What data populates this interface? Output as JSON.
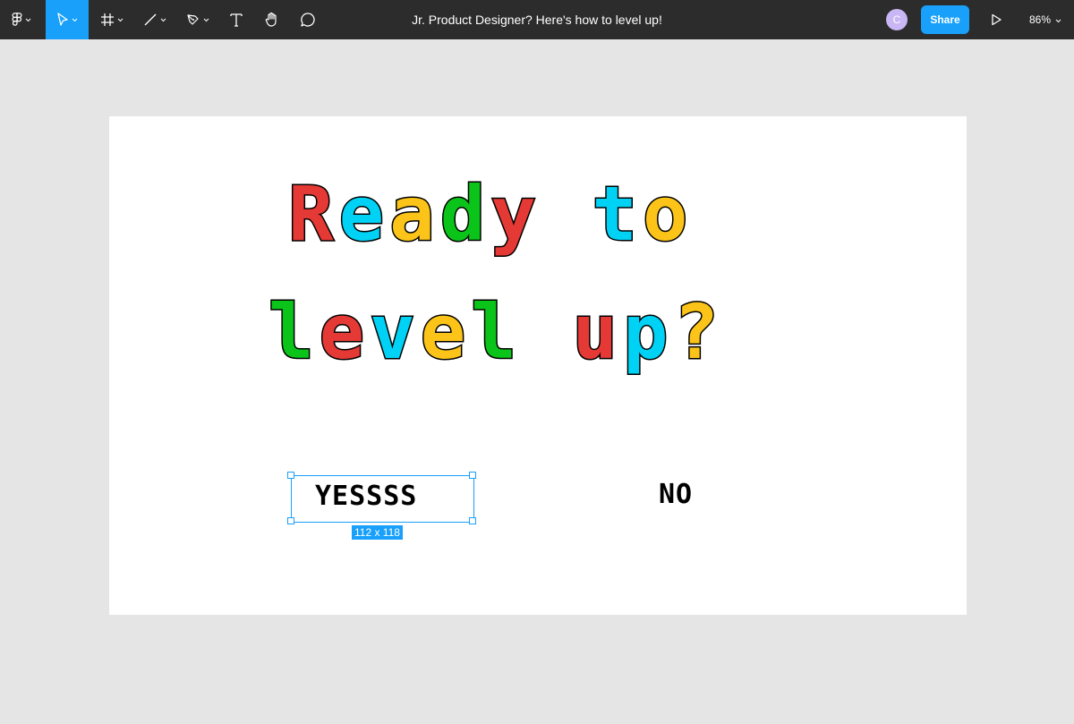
{
  "toolbar": {
    "tools": [
      {
        "name": "figma-menu-icon"
      },
      {
        "name": "move-tool-icon"
      },
      {
        "name": "frame-tool-icon"
      },
      {
        "name": "line-tool-icon"
      },
      {
        "name": "pen-tool-icon"
      },
      {
        "name": "text-tool-icon"
      },
      {
        "name": "hand-tool-icon"
      },
      {
        "name": "comment-tool-icon"
      }
    ],
    "active_tool": "move-tool",
    "accent_color": "#18a0fb",
    "document_title": "Jr. Product Designer? Here's how to level up!",
    "avatar_initial": "C",
    "avatar_color": "#c9b6f5",
    "share_label": "Share",
    "zoom_label": "86%"
  },
  "canvas": {
    "headline_line1": [
      "R",
      "e",
      "a",
      "d",
      "y",
      " ",
      "t",
      "o"
    ],
    "headline_line1_colors": [
      "#e53935",
      "#00d2f5",
      "#fcc419",
      "#0bc419",
      "#e53935",
      "",
      "#00d2f5",
      "#fcc419"
    ],
    "headline_line2": [
      "l",
      "e",
      "v",
      "e",
      "l",
      " ",
      "u",
      "p",
      "?"
    ],
    "headline_line2_colors": [
      "#0bc419",
      "#e53935",
      "#00d2f5",
      "#fcc419",
      "#0bc419",
      "",
      "#e53935",
      "#00d2f5",
      "#fcc419"
    ],
    "option_yes": "YESSSS",
    "option_no": "NO",
    "selection_size": "112 x 118"
  }
}
